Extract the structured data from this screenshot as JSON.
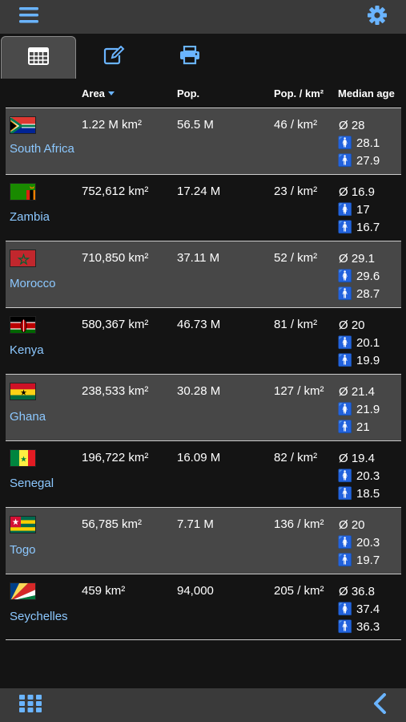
{
  "topbar": {
    "menu_icon": "hamburger-menu-icon",
    "settings_icon": "gear-icon"
  },
  "tabs": [
    {
      "icon": "table-grid-icon",
      "active": true
    },
    {
      "icon": "edit-icon",
      "active": false
    },
    {
      "icon": "print-icon",
      "active": false
    }
  ],
  "table": {
    "headers": {
      "area": "Area",
      "population": "Pop.",
      "density": "Pop. / km²",
      "median_age": "Median age"
    },
    "sort_column": "area",
    "rows": [
      {
        "country": "South Africa",
        "flag": "south-africa-flag",
        "area": "1.22 M km²",
        "population": "56.5 M",
        "density": "46 / km²",
        "age_total": "Ø 28",
        "age_female": "28.1",
        "age_male": "27.9"
      },
      {
        "country": "Zambia",
        "flag": "zambia-flag",
        "area": "752,612 km²",
        "population": "17.24 M",
        "density": "23 / km²",
        "age_total": "Ø 16.9",
        "age_female": "17",
        "age_male": "16.7"
      },
      {
        "country": "Morocco",
        "flag": "morocco-flag",
        "area": "710,850 km²",
        "population": "37.11 M",
        "density": "52 / km²",
        "age_total": "Ø 29.1",
        "age_female": "29.6",
        "age_male": "28.7"
      },
      {
        "country": "Kenya",
        "flag": "kenya-flag",
        "area": "580,367 km²",
        "population": "46.73 M",
        "density": "81 / km²",
        "age_total": "Ø 20",
        "age_female": "20.1",
        "age_male": "19.9"
      },
      {
        "country": "Ghana",
        "flag": "ghana-flag",
        "area": "238,533 km²",
        "population": "30.28 M",
        "density": "127 / km²",
        "age_total": "Ø 21.4",
        "age_female": "21.9",
        "age_male": "21"
      },
      {
        "country": "Senegal",
        "flag": "senegal-flag",
        "area": "196,722 km²",
        "population": "16.09 M",
        "density": "82 / km²",
        "age_total": "Ø 19.4",
        "age_female": "20.3",
        "age_male": "18.5"
      },
      {
        "country": "Togo",
        "flag": "togo-flag",
        "area": "56,785 km²",
        "population": "7.71 M",
        "density": "136 / km²",
        "age_total": "Ø 20",
        "age_female": "20.3",
        "age_male": "19.7"
      },
      {
        "country": "Seychelles",
        "flag": "seychelles-flag",
        "area": "459 km²",
        "population": "94,000",
        "density": "205 / km²",
        "age_total": "Ø 36.8",
        "age_female": "37.4",
        "age_male": "36.3"
      }
    ]
  },
  "bottombar": {
    "apps_icon": "apps-grid-icon",
    "back_icon": "chevron-left-icon"
  },
  "colors": {
    "accent": "#6ab4ff",
    "link": "#8cc8ff",
    "bar": "#3a3a3a",
    "row_alt": "#474747",
    "background": "#141414"
  }
}
